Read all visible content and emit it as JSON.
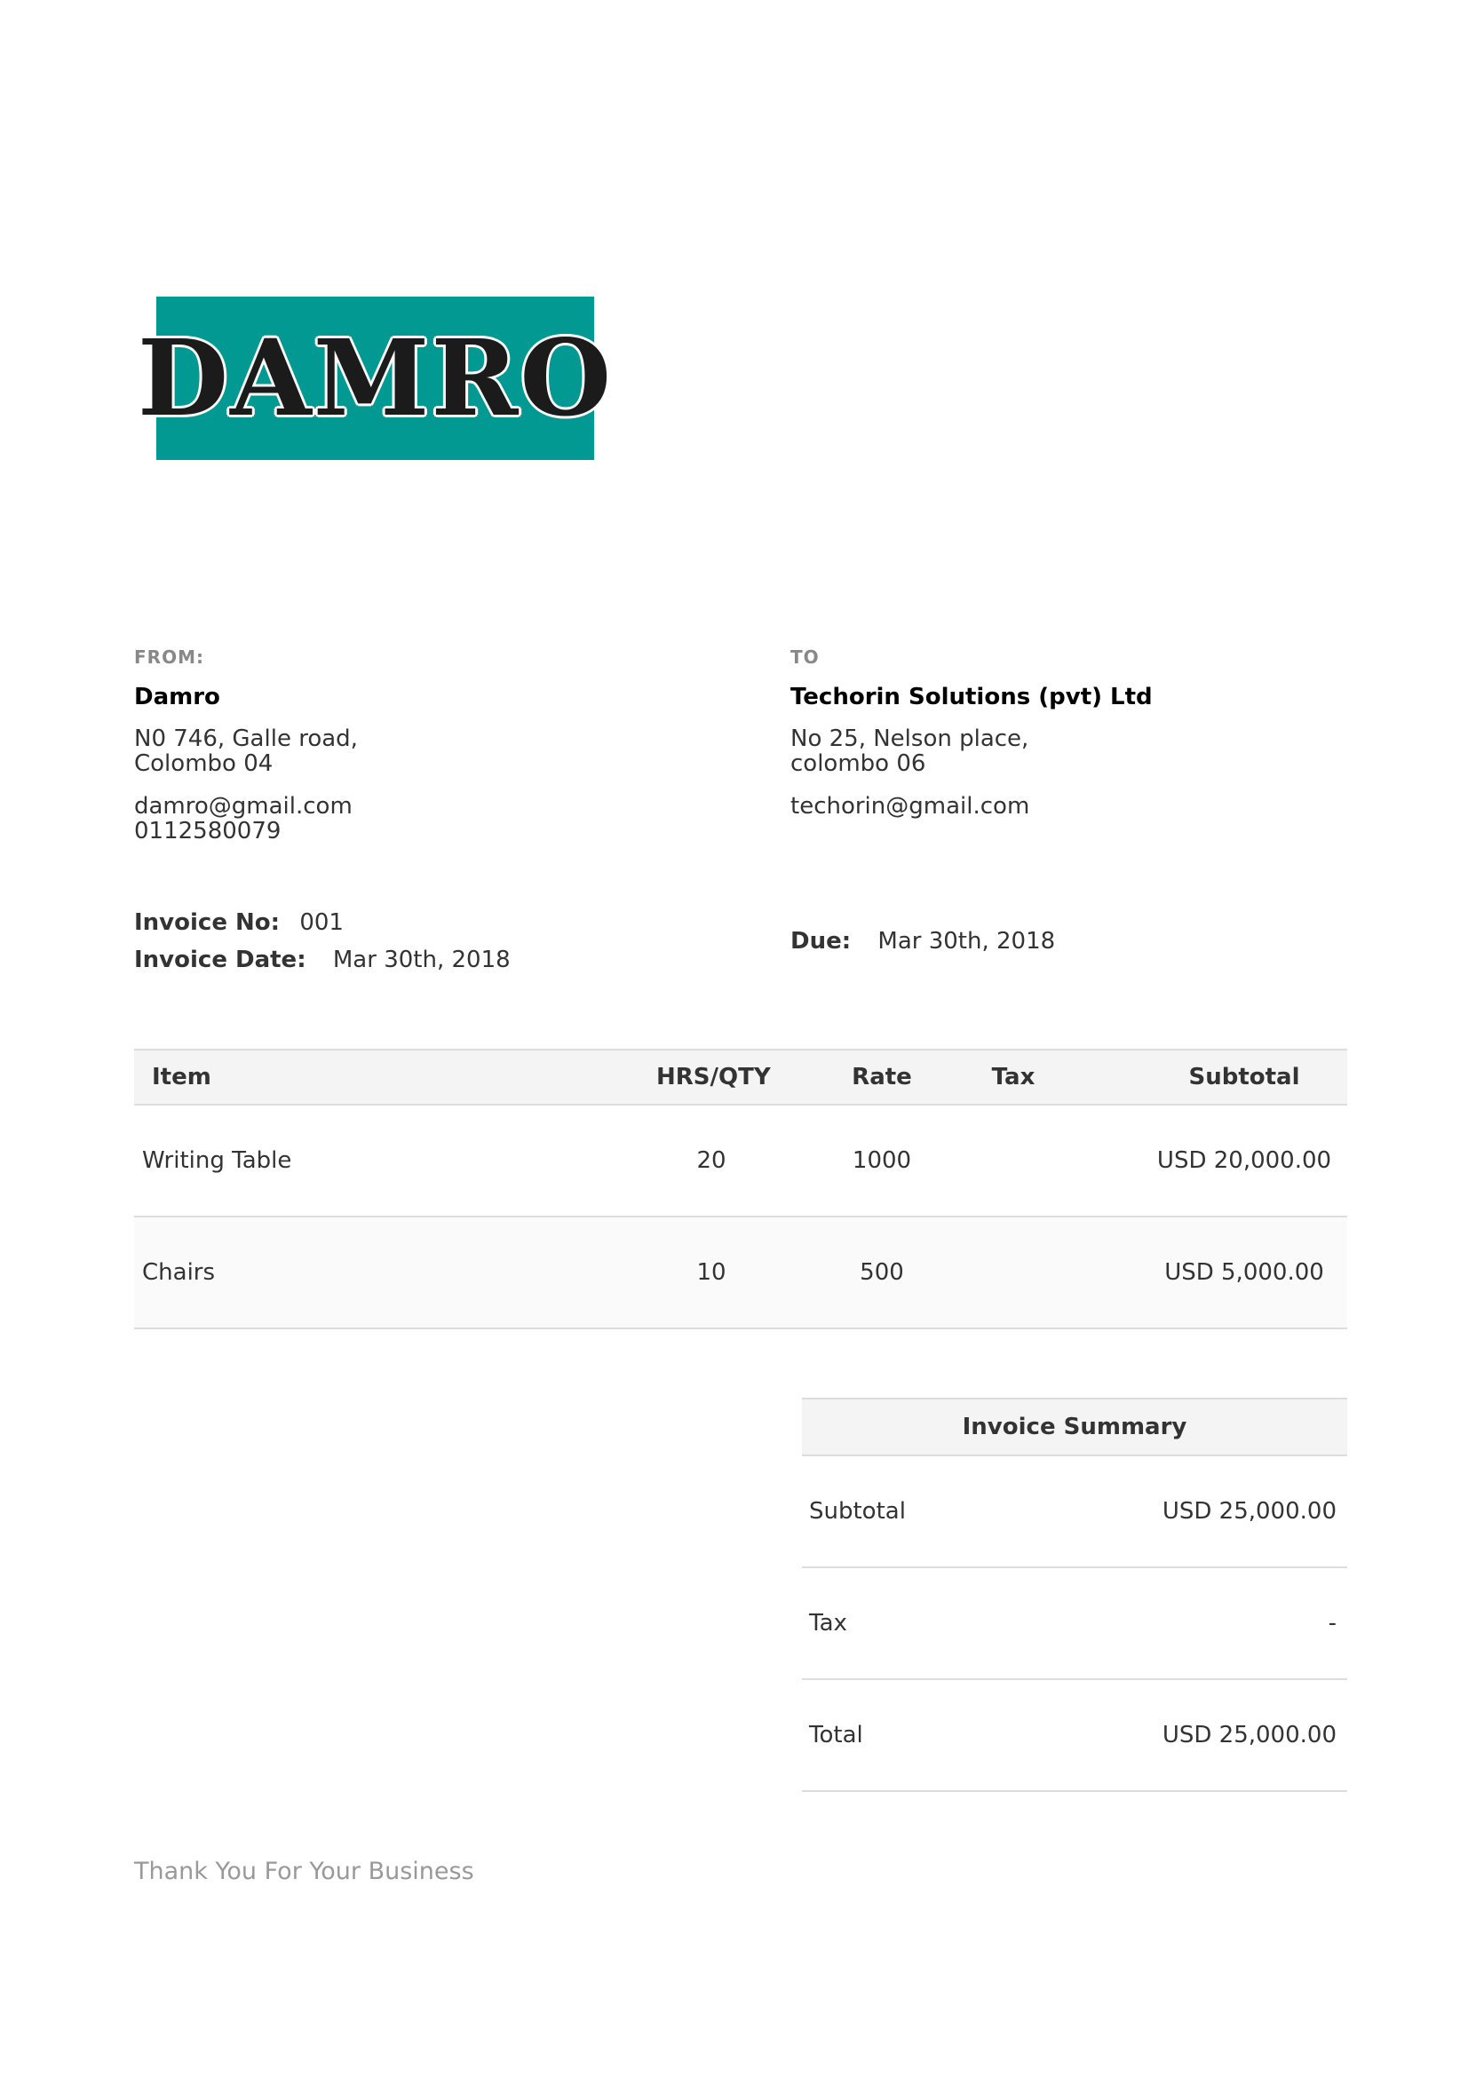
{
  "logo": {
    "text": "DAMRO",
    "color": "#029993"
  },
  "from": {
    "label": "FROM:",
    "name": "Damro",
    "address_line1": "N0 746, Galle road,",
    "address_line2": "Colombo 04",
    "email": "damro@gmail.com",
    "phone": "0112580079"
  },
  "to": {
    "label": "TO",
    "name": "Techorin Solutions (pvt) Ltd",
    "address_line1": "No 25, Nelson place,",
    "address_line2": "colombo 06",
    "email": "techorin@gmail.com"
  },
  "meta": {
    "invoice_no_label": "Invoice No",
    "invoice_no": "001",
    "invoice_date_label": "Invoice Date",
    "invoice_date": "Mar 30th, 2018",
    "due_label": "Due:",
    "due_date": "Mar 30th, 2018"
  },
  "items_table": {
    "headers": {
      "item": "Item",
      "qty": "HRS/QTY",
      "rate": "Rate",
      "tax": "Tax",
      "subtotal": "Subtotal"
    },
    "rows": [
      {
        "item": "Writing Table",
        "qty": "20",
        "rate": "1000",
        "tax": "",
        "subtotal": "USD 20,000.00"
      },
      {
        "item": "Chairs",
        "qty": "10",
        "rate": "500",
        "tax": "",
        "subtotal": "USD 5,000.00"
      }
    ]
  },
  "summary": {
    "title": "Invoice Summary",
    "rows": [
      {
        "label": "Subtotal",
        "value": "USD 25,000.00"
      },
      {
        "label": "Tax",
        "value": "-"
      },
      {
        "label": "Total",
        "value": "USD 25,000.00"
      }
    ]
  },
  "footer": {
    "text": "Thank You For Your Business"
  }
}
